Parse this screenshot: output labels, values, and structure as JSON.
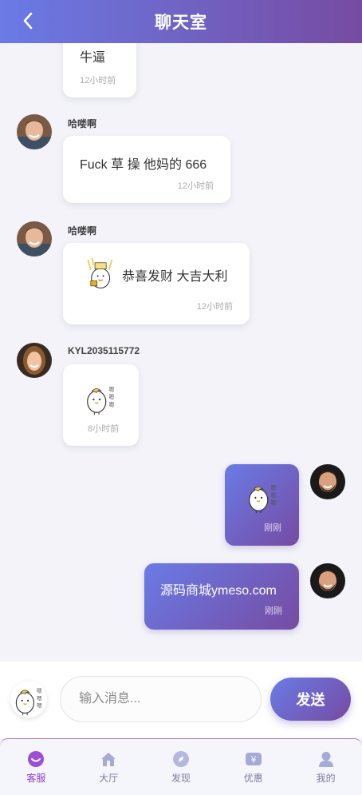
{
  "header": {
    "title": "聊天室"
  },
  "messages": [
    {
      "text": "牛逼",
      "time": "12小时前"
    },
    {
      "user": "哈喽啊",
      "text": "Fuck 草 操 他妈的 666",
      "time": "12小时前"
    },
    {
      "user": "哈喽啊",
      "text": "恭喜发财 大吉大利",
      "time": "12小时前"
    },
    {
      "user": "KYL2035115772",
      "time": "8小时前"
    },
    {
      "time": "刚刚"
    },
    {
      "text": "源码商城ymeso.com",
      "time": "刚刚"
    }
  ],
  "input": {
    "placeholder": "输入消息...",
    "send_label": "发送"
  },
  "tabs": [
    {
      "label": "客服",
      "icon": "customer-service-icon",
      "active": true
    },
    {
      "label": "大厅",
      "icon": "home-icon",
      "active": false
    },
    {
      "label": "发现",
      "icon": "compass-icon",
      "active": false
    },
    {
      "label": "优惠",
      "icon": "yen-ticket-icon",
      "active": false
    },
    {
      "label": "我的",
      "icon": "user-icon",
      "active": false
    }
  ],
  "colors": {
    "gradient_start": "#6a7be6",
    "gradient_end": "#764ba2",
    "active_tab": "#8b3fc8"
  }
}
